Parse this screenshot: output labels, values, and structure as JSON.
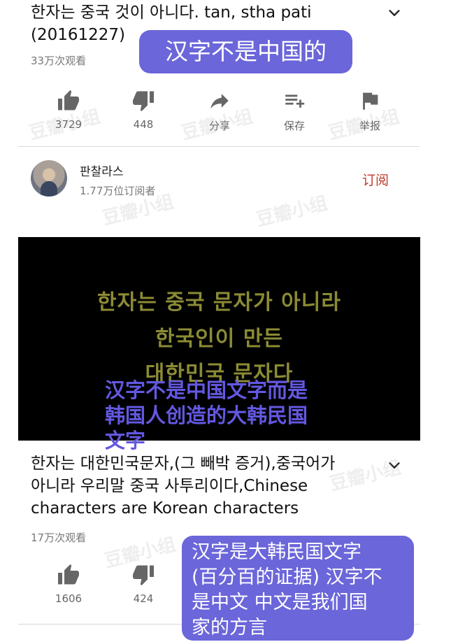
{
  "video1": {
    "title_line1": "한자는 중국 것이 아니다. tan, stha pati",
    "title_line2": "(20161227)",
    "views": "33万次观看",
    "actions": [
      {
        "icon": "thumbs-up-icon",
        "label": "3729"
      },
      {
        "icon": "thumbs-down-icon",
        "label": "448"
      },
      {
        "icon": "share-icon",
        "label": "分享"
      },
      {
        "icon": "save-playlist-icon",
        "label": "保存"
      },
      {
        "icon": "flag-icon",
        "label": "举报"
      }
    ]
  },
  "annotation1": "汉字不是中国的",
  "channel": {
    "name": "판찰라스",
    "subscribers": "1.77万位订阅者",
    "subscribe_label": "订阅"
  },
  "video_frame": {
    "korean_lines": [
      "한자는 중국 문자가 아니라",
      "한국인이 만든",
      "대한민국 문자다"
    ],
    "chinese_overlay": [
      "汉字不是中国文字而是",
      "韩国人创造的大韩民国",
      "文字"
    ]
  },
  "video2": {
    "title_line1": "한자는 대한민국문자,(그 빼박 증거),중국어가",
    "title_line2": "아니라 우리말 중국 사투리이다,Chinese",
    "title_line3": "characters are Korean characters",
    "views": "17万次观看",
    "actions": [
      {
        "icon": "thumbs-up-icon",
        "label": "1606"
      },
      {
        "icon": "thumbs-down-icon",
        "label": "424"
      }
    ]
  },
  "annotation2": [
    "汉字是大韩民国文字",
    "(百分百的证据) 汉字不",
    "是中文 中文是我们国",
    "家的方言"
  ],
  "watermark_text": "豆瓣小组",
  "colors": {
    "bubble": "#6b66d9",
    "overlay_text": "#6358e0",
    "subscribe": "#c0392b",
    "video_text": "#8b8b35"
  }
}
